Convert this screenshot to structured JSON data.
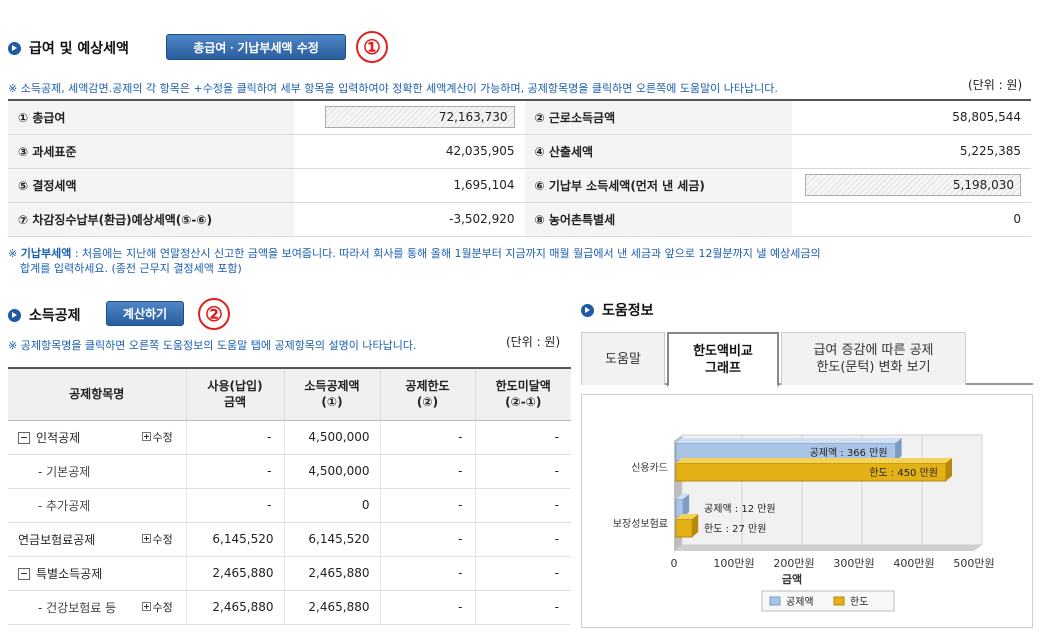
{
  "section1": {
    "title": "급여 및 예상세액",
    "edit_button": "총급여ㆍ기납부세액 수정",
    "marker": "①",
    "note": "※ 소득공제, 세액감면.공제의 각 항목은 +수정을 클릭하여 세부 항목을 입력하여야 정확한 세액계산이 가능하며, 공제항목명을 클릭하면 오른쪽에 도움말이 나타납니다.",
    "unit": "(단위 : 원)",
    "rows": [
      {
        "l1": "① 총급여",
        "v1": "72,163,730",
        "l2": "② 근로소득금액",
        "v2": "58,805,544"
      },
      {
        "l1": "③ 과세표준",
        "v1": "42,035,905",
        "l2": "④ 산출세액",
        "v2": "5,225,385"
      },
      {
        "l1": "⑤ 결정세액",
        "v1": "1,695,104",
        "l2": "⑥ 기납부 소득세액(먼저 낸 세금)",
        "v2": "5,198,030"
      },
      {
        "l1": "⑦ 차감징수납부(환급)예상세액(⑤-⑥)",
        "v1": "-3,502,920",
        "l2": "⑧ 농어촌특별세",
        "v2": "0"
      }
    ],
    "note2_bold": "기납부세액",
    "note2_line1": " : 처음에는 지난해 연말정산시 신고한 금액을 보여줍니다. 따라서 회사를 통해 올해 1월분부터 지금까지 매월 월급에서 낸 세금과 앞으로 12월분까지 낼 예상세금의",
    "note2_line2": "합계를 입력하세요. (종전 근무지 결정세액 포함)",
    "note2_prefix": "※ "
  },
  "section2": {
    "title": "소득공제",
    "calc_button": "계산하기",
    "marker": "②",
    "note": "※ 공제항목명을 클릭하면 오른쪽 도움정보의 도움말 탭에 공제항목의 설명이 나타납니다.",
    "unit": "(단위 : 원)",
    "headers": {
      "name": "공제항목명",
      "amount_1": "사용(납입)",
      "amount_2": "금액",
      "ded_1": "소득공제액",
      "ded_2": "(①)",
      "limit_1": "공제한도",
      "limit_2": "(②)",
      "remain_1": "한도미달액",
      "remain_2": "(②-①)"
    },
    "edit_label": "수정",
    "rows": [
      {
        "name": "인적공제",
        "amount": "-",
        "deduction": "4,500,000",
        "limit": "-",
        "remain": "-"
      },
      {
        "name": "- 기본공제",
        "amount": "-",
        "deduction": "4,500,000",
        "limit": "-",
        "remain": "-"
      },
      {
        "name": "- 추가공제",
        "amount": "-",
        "deduction": "0",
        "limit": "-",
        "remain": "-"
      },
      {
        "name": "연금보험료공제",
        "amount": "6,145,520",
        "deduction": "6,145,520",
        "limit": "-",
        "remain": "-"
      },
      {
        "name": "특별소득공제",
        "amount": "2,465,880",
        "deduction": "2,465,880",
        "limit": "-",
        "remain": "-"
      },
      {
        "name": "- 건강보험료 등",
        "amount": "2,465,880",
        "deduction": "2,465,880",
        "limit": "-",
        "remain": "-"
      }
    ]
  },
  "help": {
    "title": "도움정보",
    "tabs": [
      "도움말",
      "한도액비교 그래프",
      "급여 증감에 따른 공제 한도(문턱) 변화 보기"
    ],
    "tab2_line1": "한도액비교",
    "tab2_line2": "그래프",
    "tab3_line1": "급여 증감에 따른 공제",
    "tab3_line2": "한도(문턱) 변화 보기",
    "active_tab": 1
  },
  "chart_data": {
    "type": "bar",
    "orientation": "horizontal",
    "categories": [
      "신용카드",
      "보장성보험료"
    ],
    "series": [
      {
        "name": "공제액",
        "values": [
          366,
          12
        ],
        "labels": [
          "공제액 : 366 만원",
          "공제액 : 12 만원"
        ],
        "color": "#a9c4e4"
      },
      {
        "name": "한도",
        "values": [
          450,
          27
        ],
        "labels": [
          "한도 : 450 만원",
          "한도 : 27 만원"
        ],
        "color": "#e3b016"
      }
    ],
    "xticks": [
      "0",
      "100만원",
      "200만원",
      "300만원",
      "400만원",
      "500만원"
    ],
    "xlabel": "금액",
    "xlim": [
      0,
      500
    ],
    "legend": [
      "공제액",
      "한도"
    ],
    "legend_position": "bottom",
    "grid": true
  }
}
